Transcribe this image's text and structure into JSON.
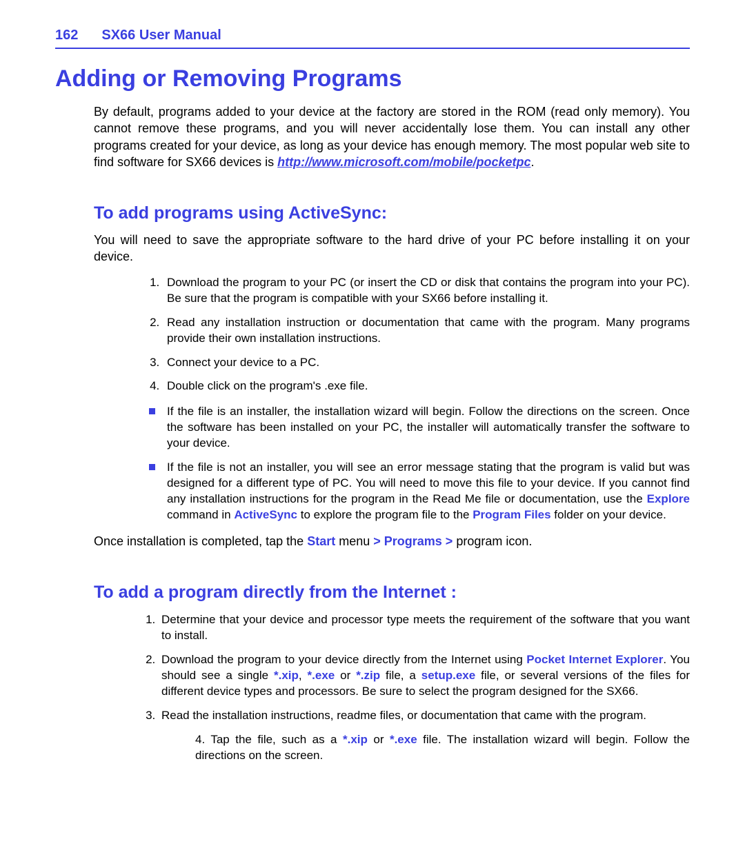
{
  "header": {
    "page_number": "162",
    "manual_title": "SX66 User Manual"
  },
  "title": "Adding or Removing Programs",
  "intro": {
    "text_before_link": "By default, programs added to your device at the factory are stored in the ROM (read only memory). You cannot remove these programs, and you will never accidentally lose them. You can install any other programs created for your device, as long as your device has enough memory. The most popular web site to find software for SX66 devices is ",
    "link_text": "http://www.microsoft.com/mobile/pocketpc",
    "text_after_link": "."
  },
  "section1": {
    "heading": "To add programs using ActiveSync:",
    "lead": "You will need to save the appropriate software to the hard drive of your PC before installing it on your device.",
    "steps": [
      "Download the program to your PC (or insert the CD or disk that contains the program into your PC). Be sure that the program is compatible with your SX66 before installing it.",
      "Read any installation instruction or documentation that came with the program. Many programs  provide their own installation instructions.",
      "Connect your device to a PC.",
      "Double click on the program's .exe file."
    ],
    "bullets": {
      "b1": "If the file is an installer, the installation wizard will begin. Follow the directions on the screen. Once the software has been installed on your PC, the installer will automatically transfer the software to your device.",
      "b2_pre": "If the file is not an installer, you will see an error message stating that the program is valid but was designed for a different type of PC. You will need to move this file to your device. If you cannot find any installation instructions for the program in the Read Me file or documentation, use the ",
      "b2_hl1": "Explore",
      "b2_mid1": " command in ",
      "b2_hl2": "ActiveSync",
      "b2_mid2": " to explore the program file to the ",
      "b2_hl3": "Program Files",
      "b2_post": " folder on your device."
    },
    "closing": {
      "pre": "Once installation is completed, tap the ",
      "hl1": "Start",
      "mid1": " menu ",
      "gt1": "> ",
      "hl2": "Programs",
      "gt2": " > ",
      "post": "program icon."
    }
  },
  "section2": {
    "heading": "To add a program directly from the Internet :",
    "steps": {
      "s1": "Determine that your device and processor type meets the requirement of the software that you want to install.",
      "s2_pre": "Download the program to your device directly from the Internet using ",
      "s2_hl1": "Pocket Internet Explorer",
      "s2_mid1": ". You should see a single ",
      "s2_hl2": "*.xip",
      "s2_c1": ", ",
      "s2_hl3": "*.exe",
      "s2_mid2": " or ",
      "s2_hl4": "*.zip",
      "s2_mid3": " file, a ",
      "s2_hl5": "setup.exe",
      "s2_post": " file, or several versions of the files for different device types and processors. Be sure to select the program designed for the SX66.",
      "s3": "Read the installation instructions, readme files, or documentation that came with the program.",
      "s4_pre": "4. Tap the file, such as a ",
      "s4_hl1": "*.xip",
      "s4_mid": " or ",
      "s4_hl2": "*.exe",
      "s4_post": " file. The installation wizard will begin. Follow the directions on the screen."
    }
  }
}
